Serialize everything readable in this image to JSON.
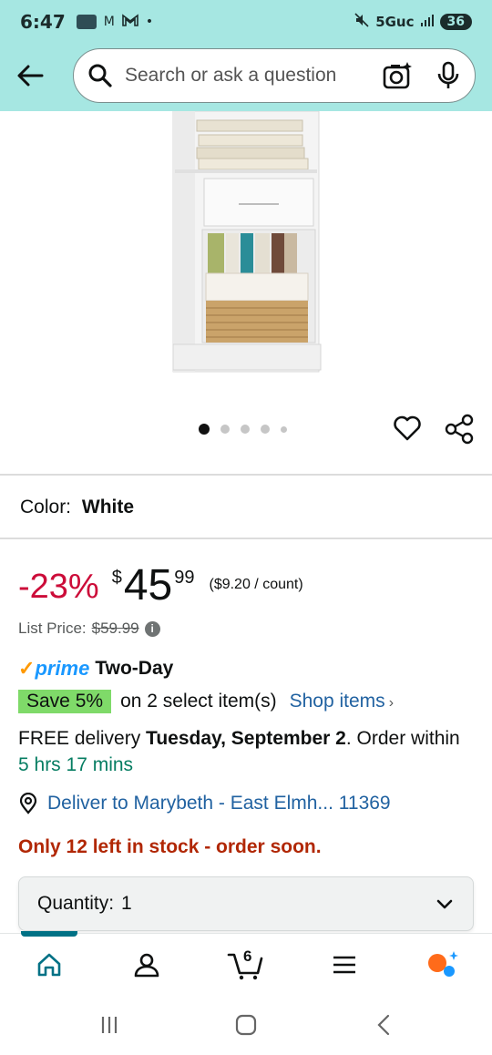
{
  "status_bar": {
    "time": "6:47",
    "notif_letters": "M",
    "network": "5Guc",
    "battery": "36"
  },
  "header": {
    "search_placeholder": "Search or ask a question"
  },
  "product": {
    "image_dots": 5,
    "active_dot": 1,
    "color_label": "Color:",
    "color_value": "White",
    "discount": "-23%",
    "currency": "$",
    "price_whole": "45",
    "price_fraction": "99",
    "unit_price": "($9.20 / count)",
    "list_price_label": "List Price:",
    "list_price_value": "$59.99",
    "prime_label": "prime",
    "prime_speed": "Two-Day",
    "save_badge": "Save 5%",
    "save_text": "on 2 select item(s)",
    "shop_items": "Shop items",
    "delivery_prefix": "FREE delivery",
    "delivery_date": "Tuesday, September 2",
    "delivery_order": ". Order within",
    "delivery_countdown": "5 hrs 17 mins",
    "deliver_to": "Deliver to Marybeth - East Elmh... 11369",
    "stock": "Only 12 left in stock - order soon.",
    "quantity_label": "Quantity:",
    "quantity_value": "1"
  },
  "bottom_nav": {
    "cart_count": "6",
    "items": [
      "home",
      "account",
      "cart",
      "menu",
      "rufus"
    ]
  },
  "colors": {
    "header_bg": "#a6e7e2",
    "discount_red": "#cc0c39",
    "link_blue": "#2162a1",
    "save_green": "#7fda69",
    "stock_red": "#b12704",
    "teal": "#007185"
  }
}
